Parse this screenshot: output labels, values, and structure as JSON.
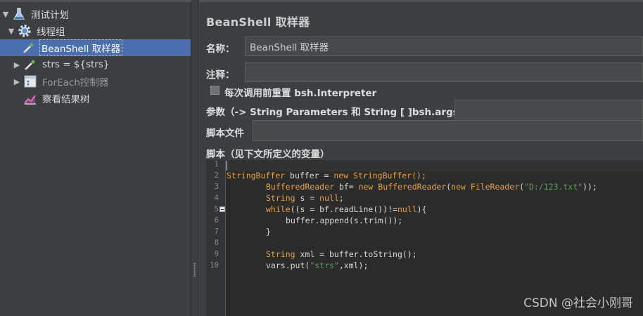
{
  "tree": {
    "items": [
      {
        "label": "测试计划",
        "icon": "test-plan-flask-icon"
      },
      {
        "label": "线程组",
        "icon": "thread-group-gear-icon"
      },
      {
        "label": "BeanShell 取样器",
        "icon": "sampler-pipette-icon",
        "selected": true
      },
      {
        "label": "strs = ${strs}",
        "icon": "sampler-pipette-icon"
      },
      {
        "label": "ForEach控制器",
        "icon": "foreach-controller-icon",
        "disabled": true
      },
      {
        "label": "察看结果树",
        "icon": "result-tree-chart-icon"
      }
    ]
  },
  "editor": {
    "title": "BeanShell 取样器",
    "name_label": "名称：",
    "name_value": "BeanShell 取样器",
    "comment_label": "注释：",
    "comment_value": "",
    "reset_checkbox_label": "每次调用前重置 bsh.Interpreter",
    "params_label": "参数（-> String Parameters 和 String [ ]bsh.args）",
    "params_value": "",
    "script_file_label": "脚本文件",
    "script_file_value": "",
    "script_label": "脚本（见下文所定义的变量）",
    "line_numbers": [
      "1",
      "2",
      "3",
      "4",
      "5",
      "6",
      "7",
      "8",
      "9",
      "10"
    ]
  },
  "code": {
    "line2_type": "StringBuffer",
    "line2_mid": " buffer = ",
    "line2_new": "new",
    "line2_rest": " StringBuffer();",
    "line3_type": "BufferedReader",
    "line3_mid": " bf= ",
    "line3_new": "new",
    "line3_type2": " BufferedReader",
    "line3_p": "(",
    "line3_new2": "new",
    "line3_type3": " FileReader",
    "line3_p2": "(",
    "line3_str": "\"D:/123.txt\"",
    "line3_end": "));",
    "line4_type": "String",
    "line4_mid": " s = ",
    "line4_null": "null",
    "line4_end": ";",
    "line5_kw": "while",
    "line5_mid": "((s = bf.readLine())!=",
    "line5_null": "null",
    "line5_end": "){",
    "line6": "buffer.append(s.trim());",
    "line7": "}",
    "line9_type": "String",
    "line9_rest": " xml = buffer.toString();",
    "line10_a": "vars.put(",
    "line10_str": "\"strs\"",
    "line10_b": ",xml);"
  },
  "watermark": "CSDN @社会小刚哥",
  "colors": {
    "selection": "#4b6eaf",
    "keyword": "#e8a13a",
    "string": "#5f9e53",
    "background": "#3c3f41",
    "code_bg": "#2b2b2b"
  }
}
